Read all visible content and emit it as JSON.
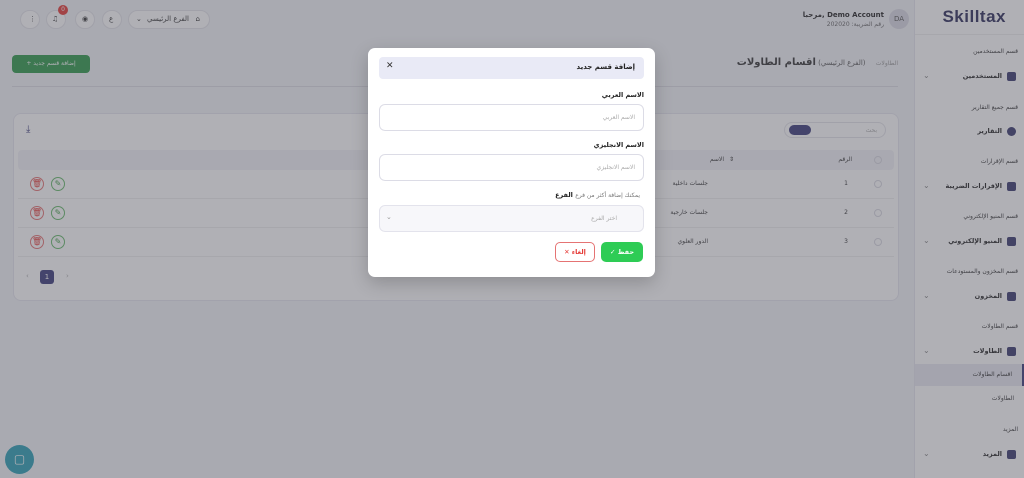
{
  "app": {
    "logo": "Skilltax"
  },
  "header": {
    "account_name": "Demo Account",
    "greeting": "مرحبا,",
    "avatar_initials": "DA",
    "tax_label": "رقم الضريبة: 202020",
    "branch_selector": "الفرع الرئيسي",
    "notification_count": "0"
  },
  "sidebar": {
    "sections": [
      {
        "caption": "قسم المستخدمين",
        "item": "المستخدمين",
        "icon": "users-grid-icon"
      },
      {
        "caption": "قسم جميع التقارير",
        "item": "التقارير",
        "icon": "pie-chart-icon"
      },
      {
        "caption": "قسم الإقرارات",
        "item": "الإقرارات الضريبة",
        "icon": "grid-icon"
      },
      {
        "caption": "قسم المنيو الإلكتروني",
        "item": "المنيو الإلكتروني",
        "icon": "menu-book-icon"
      },
      {
        "caption": "قسم المخزون والمستودعات",
        "item": "المخزون",
        "icon": "box-icon"
      },
      {
        "caption": "قسم الطاولات",
        "item": "الطاولات",
        "icon": "table-icon"
      },
      {
        "caption": "المزيد",
        "item": "المزيد",
        "icon": "grid-icon"
      }
    ],
    "subitems": [
      "اقسام الطاولات",
      "الطاولات"
    ]
  },
  "page": {
    "title": "اقسام الطاولات",
    "branch": "(الفرع الرئيسي)",
    "breadcrumb_small": "الطاولات",
    "add_button": "+ إضافة قسم جديد"
  },
  "table": {
    "search_placeholder": "بحث",
    "columns": {
      "number": "الرقم",
      "name": "الاسم"
    },
    "rows": [
      {
        "number": "1",
        "name": "جلسات داخلية"
      },
      {
        "number": "2",
        "name": "جلسات خارجية"
      },
      {
        "number": "3",
        "name": "الدور العلوي"
      }
    ],
    "current_page": "1"
  },
  "modal": {
    "title": "إضافة قسم جديد",
    "arabic_name_label": "الاسم العربي",
    "arabic_name_placeholder": "الاسم العربي",
    "english_name_label": "الاسم الانجليزي",
    "english_name_placeholder": "الاسم الانجليزي",
    "branch_label": "الفرع",
    "branch_hint": "يمكنك إضافة أكثر من فرع",
    "branch_select_placeholder": "اختر الفرع",
    "save_label": "حفظ",
    "cancel_label": "إلغاء"
  },
  "colors": {
    "primary": "#3b3b7a",
    "save": "#2ecc55",
    "cancel": "#e53935",
    "add_button": "#2e9a4a",
    "chat_button": "#2a9fb5"
  }
}
